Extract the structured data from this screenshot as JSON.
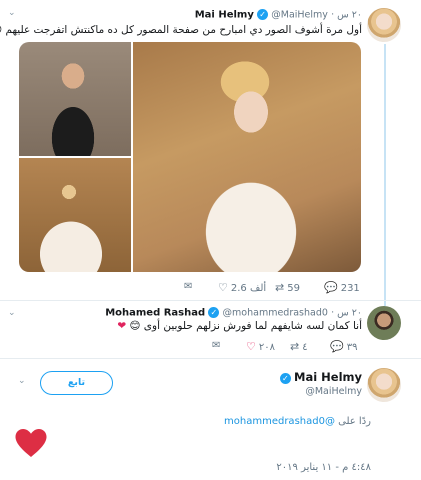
{
  "tweet1": {
    "name": "Mai Helmy",
    "handle": "@MaiHelmy",
    "time": "٢٠ س",
    "text": "أول مرة أشوف الصور دي امبارح من صفحة المصور كل ده ماكنتش اتفرجت عليهم",
    "emoji": "😊",
    "counts": {
      "replies": "231",
      "retweets": "59",
      "likes": "2.6 ألف"
    }
  },
  "tweet2": {
    "name": "Mohamed Rashad",
    "handle": "@mohammedrashad0",
    "time": "٢٠ س",
    "text": "أنا كمان لسه شايفهم لما فورش نزلهم حلوبين أوى",
    "emoji": "😊",
    "counts": {
      "replies": "٣٩",
      "retweets": "٤",
      "likes": "٢٠٨"
    }
  },
  "main": {
    "name": "Mai Helmy",
    "handle": "@MaiHelmy",
    "follow_label": "تابع",
    "replying_prefix": "ردًا على",
    "replying_to": "@mohammedrashad0",
    "timestamp": "٤:٤٨ م - ١١ يناير ٢٠١٩"
  },
  "colors": {
    "accent": "#1da1f2",
    "like": "#e0245e",
    "muted": "#657786",
    "thread": "#c7e3f5"
  },
  "icons": [
    "chevron-down-icon",
    "verified-icon",
    "reply-icon",
    "retweet-icon",
    "like-icon",
    "message-icon",
    "heart-emoji-icon",
    "smile-emoji-icon"
  ]
}
